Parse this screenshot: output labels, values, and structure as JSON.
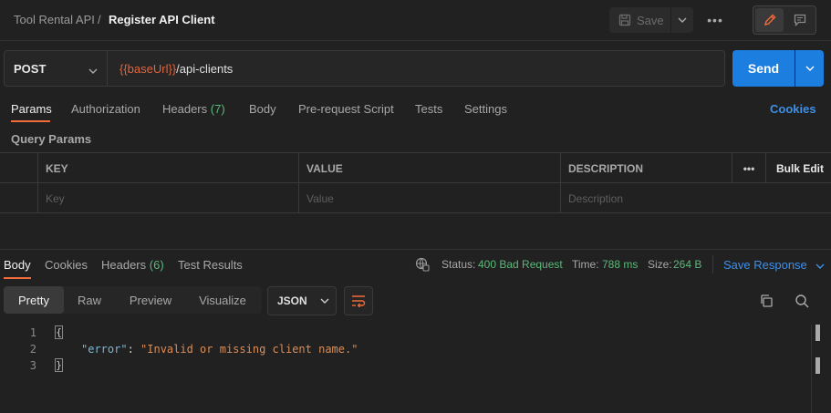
{
  "header": {
    "collection": "Tool Rental API",
    "separator": "/",
    "request_name": "Register API Client",
    "save_label": "Save",
    "more_label": "•••"
  },
  "request": {
    "method": "POST",
    "url_variable": "{{baseUrl}}",
    "url_path": "/api-clients",
    "send_label": "Send"
  },
  "request_tabs": [
    {
      "label": "Params"
    },
    {
      "label": "Authorization"
    },
    {
      "label": "Headers",
      "count": "(7)"
    },
    {
      "label": "Body"
    },
    {
      "label": "Pre-request Script"
    },
    {
      "label": "Tests"
    },
    {
      "label": "Settings"
    }
  ],
  "cookies_label": "Cookies",
  "query_params": {
    "title": "Query Params",
    "columns": [
      "KEY",
      "VALUE",
      "DESCRIPTION"
    ],
    "more_label": "•••",
    "bulk_edit_label": "Bulk Edit",
    "placeholders": [
      "Key",
      "Value",
      "Description"
    ]
  },
  "response": {
    "tabs": [
      {
        "label": "Body"
      },
      {
        "label": "Cookies"
      },
      {
        "label": "Headers",
        "count": "(6)"
      },
      {
        "label": "Test Results"
      }
    ],
    "status_label": "Status:",
    "status_value": "400 Bad Request",
    "time_label": "Time:",
    "time_value": "788 ms",
    "size_label": "Size:",
    "size_value": "264 B",
    "save_response_label": "Save Response",
    "format_tabs": [
      "Pretty",
      "Raw",
      "Preview",
      "Visualize"
    ],
    "language": "JSON",
    "body_lines": [
      {
        "num": "1",
        "text": "{"
      },
      {
        "num": "2",
        "key": "\"error\"",
        "colon": ": ",
        "value": "\"Invalid or missing client name.\""
      },
      {
        "num": "3",
        "text": "}"
      }
    ]
  },
  "colors": {
    "accent": "#f26b3a",
    "send": "#1c7fe0",
    "link": "#3d8fe8",
    "status_ok": "#5cb87a"
  }
}
